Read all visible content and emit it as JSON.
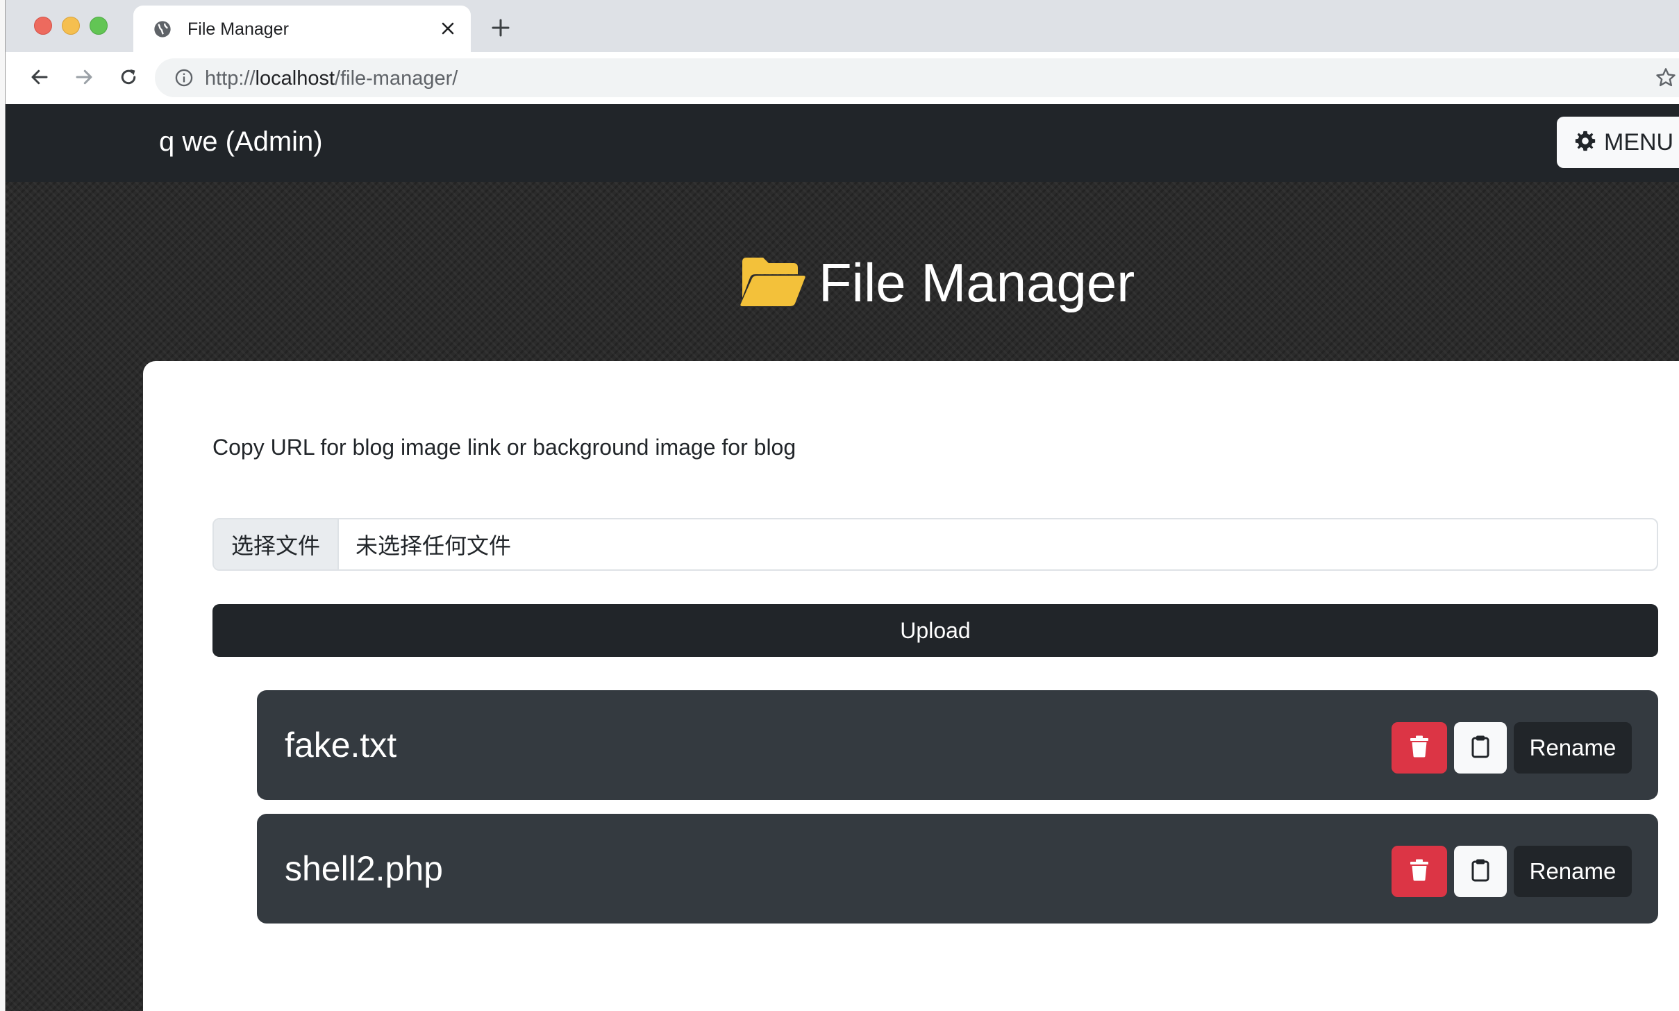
{
  "browser": {
    "tab_title": "File Manager",
    "url_scheme": "http://",
    "url_host": "localhost",
    "url_path": "/file-manager/",
    "icons": {
      "tab_favicon": "globe-icon",
      "tab_close": "close-icon",
      "new_tab": "plus-icon",
      "back": "arrow-left-icon",
      "forward": "arrow-right-icon",
      "reload": "reload-icon",
      "site_info": "info-icon",
      "bookmark": "star-icon"
    }
  },
  "navbar": {
    "brand": "q we (Admin)",
    "menu_label": "MENU",
    "menu_icon": "gear-icon"
  },
  "hero": {
    "title": "File Manager",
    "icon": "folder-open-icon",
    "icon_color": "#f3c13a"
  },
  "card": {
    "hint": "Copy URL for blog image link or background image for blog",
    "file_input": {
      "button_label": "选择文件",
      "status": "未选择任何文件"
    },
    "upload_label": "Upload"
  },
  "files": [
    {
      "name": "fake.txt",
      "rename_label": "Rename"
    },
    {
      "name": "shell2.php",
      "rename_label": "Rename"
    }
  ],
  "row_actions": {
    "delete_icon": "trash-icon",
    "copy_icon": "clipboard-icon"
  },
  "colors": {
    "navbar": "#212529",
    "danger": "#dc3545",
    "file_row": "#343a40",
    "upload": "#212529"
  }
}
